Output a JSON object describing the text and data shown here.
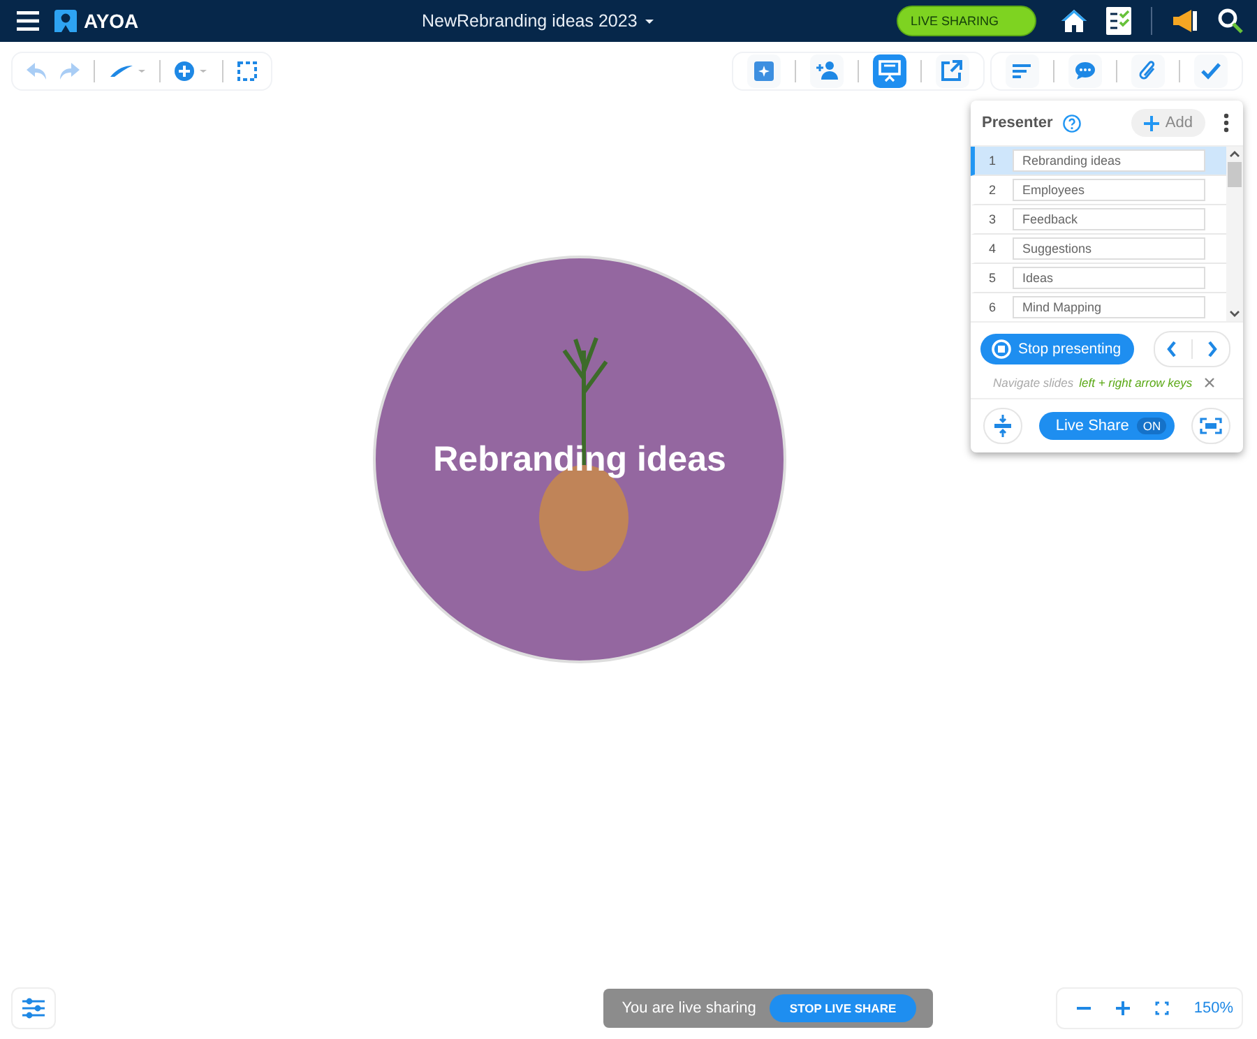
{
  "app": {
    "name": "AYOA"
  },
  "document": {
    "title": "NewRebranding ideas 2023"
  },
  "live_sharing_badge": "LIVE SHARING",
  "toolbar_tools": [
    {
      "kind": "ai",
      "selected": false
    },
    {
      "kind": "person",
      "selected": false
    },
    {
      "kind": "present",
      "selected": true
    },
    {
      "kind": "export",
      "selected": false
    }
  ],
  "toolbar_tools_2": [
    {
      "kind": "lines"
    },
    {
      "kind": "comment"
    },
    {
      "kind": "clip"
    },
    {
      "kind": "check"
    }
  ],
  "central_node": {
    "title": "Rebranding ideas"
  },
  "presenter": {
    "title": "Presenter",
    "add_button": "Add",
    "slides": [
      {
        "number": "1",
        "title": "Rebranding ideas",
        "selected": true
      },
      {
        "number": "2",
        "title": "Employees",
        "selected": false
      },
      {
        "number": "3",
        "title": "Feedback",
        "selected": false
      },
      {
        "number": "4",
        "title": "Suggestions",
        "selected": false
      },
      {
        "number": "5",
        "title": "Ideas",
        "selected": false
      },
      {
        "number": "6",
        "title": "Mind Mapping",
        "selected": false
      }
    ],
    "stop_button": "Stop presenting",
    "hint_label": "Navigate slides",
    "hint_keys": "left + right arrow keys",
    "live_share": {
      "label": "Live Share",
      "state": "ON"
    }
  },
  "sharing_bar": {
    "message": "You are live sharing",
    "button": "STOP LIVE SHARE"
  },
  "zoom": {
    "level": "150%"
  }
}
